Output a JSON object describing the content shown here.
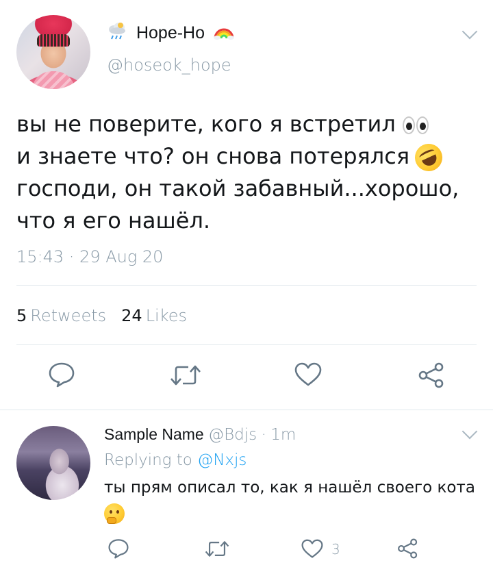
{
  "tweet": {
    "display_name": "Hope-Ho",
    "name_emoji_left": "cloud-with-rain-emoji",
    "name_emoji_right": "rainbow-emoji",
    "handle": "@hoseok_hope",
    "text_lines": [
      "вы не поверите, кого я встретил",
      "и знаете что? он снова потерялся",
      "господи, он такой забавный...хорошо,",
      "что я его нашёл."
    ],
    "timestamp": "15:43 · 29 Aug 20",
    "retweets_count": "5",
    "retweets_label": "Retweets",
    "likes_count": "24",
    "likes_label": "Likes",
    "actions": [
      "reply-icon",
      "retweet-icon",
      "like-icon",
      "share-icon"
    ]
  },
  "reply": {
    "display_name": "Sample Name",
    "handle": "@Bdjs",
    "separator": "·",
    "time": "1m",
    "replying_prefix": "Replying to",
    "replying_to": "@Nxjs",
    "text_lines": [
      "ты прям описал то, как я нашёл своего кота"
    ],
    "like_count": "3",
    "actions": [
      "reply-icon",
      "retweet-icon",
      "like-icon",
      "share-icon"
    ]
  },
  "colors": {
    "text": "#14171a",
    "secondary": "#8899a6",
    "link": "#1da1f2",
    "divider": "#e1e8ed",
    "icon": "#657786"
  }
}
